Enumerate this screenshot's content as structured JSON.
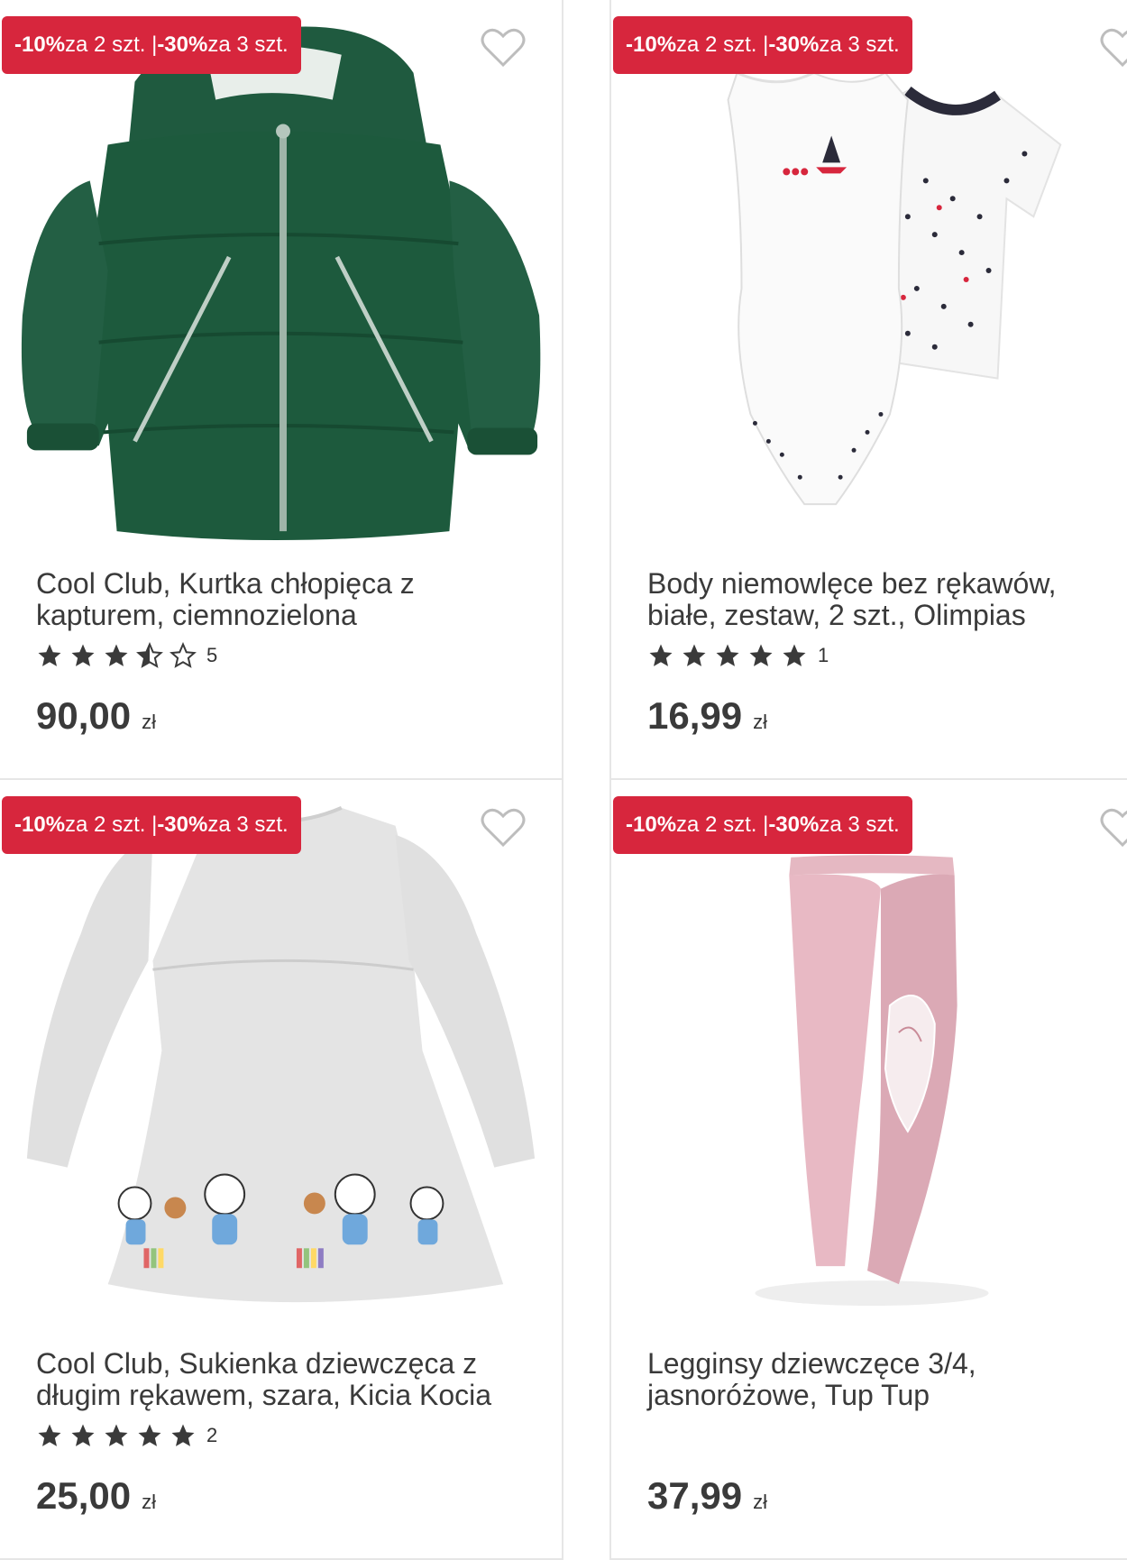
{
  "products": [
    {
      "promo_part1": "-10%",
      "promo_part2": " za 2 szt. | ",
      "promo_part3": "-30%",
      "promo_part4": " za 3 szt.",
      "title": "Cool Club, Kurtka chłopięca z kapturem, ciemnozielona",
      "rating": 3.5,
      "rating_count": "5",
      "price": "90,00",
      "currency": "zł",
      "image": "green-hooded-jacket"
    },
    {
      "promo_part1": "-10%",
      "promo_part2": " za 2 szt. | ",
      "promo_part3": "-30%",
      "promo_part4": " za 3 szt.",
      "title": "Body niemowlęce bez rękawów, białe, zestaw, 2 szt., Olimpias",
      "rating": 5,
      "rating_count": "1",
      "price": "16,99",
      "currency": "zł",
      "image": "white-baby-bodysuits"
    },
    {
      "promo_part1": "-10%",
      "promo_part2": " za 2 szt. | ",
      "promo_part3": "-30%",
      "promo_part4": " za 3 szt.",
      "title": "Cool Club, Sukienka dziewczęca z długim rękawem, szara, Kicia Kocia",
      "rating": 5,
      "rating_count": "2",
      "price": "25,00",
      "currency": "zł",
      "image": "grey-cat-dress"
    },
    {
      "promo_part1": "-10%",
      "promo_part2": " za 2 szt. | ",
      "promo_part3": "-30%",
      "promo_part4": " za 3 szt.",
      "title": "Legginsy dziewczęce 3/4, jasnoróżowe, Tup Tup",
      "rating": null,
      "rating_count": "",
      "price": "37,99",
      "currency": "zł",
      "image": "pink-leggings"
    }
  ],
  "colors": {
    "promo": "#d7263d",
    "star": "#3a3a3a",
    "text": "#3a3a3a"
  }
}
